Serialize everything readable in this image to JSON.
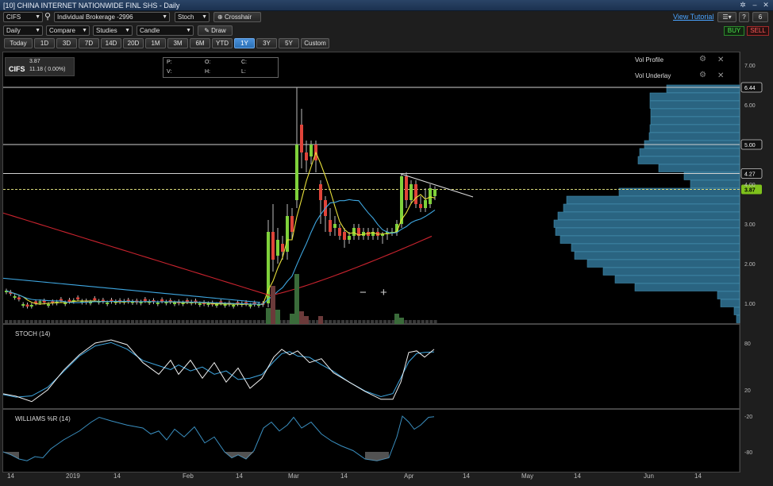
{
  "window": {
    "title": "[10] CHINA INTERNET NATIONWIDE FINL SHS - Daily"
  },
  "toolbar": {
    "symbol": "CIFS",
    "account": "Individual Brokerage -2996",
    "study_select": "Stoch",
    "crosshair_label": "Crosshair",
    "view_tutorial": "View Tutorial",
    "help": "?",
    "count": "6",
    "interval": "Daily",
    "compare": "Compare",
    "studies": "Studies",
    "chart_type": "Candle",
    "draw": "Draw",
    "buy": "BUY",
    "sell": "SELL"
  },
  "ranges": [
    "Today",
    "1D",
    "3D",
    "7D",
    "14D",
    "20D",
    "1M",
    "3M",
    "6M",
    "YTD",
    "1Y",
    "3Y",
    "5Y",
    "Custom"
  ],
  "active_range": "1Y",
  "quote": {
    "symbol": "CIFS",
    "last": "3.87",
    "volume_change": "11.18 ( 0.00%)"
  },
  "ohlc": {
    "p": "P:",
    "o": "O:",
    "c": "C:",
    "v": "V:",
    "h": "H:",
    "l": "L:"
  },
  "overlays": {
    "vol_profile": "Vol Profile",
    "vol_underlay": "Vol Underlay"
  },
  "zoom": {
    "minus": "−",
    "plus": "+"
  },
  "price_axis": [
    "7.00",
    "6.00",
    "5.00",
    "4.00",
    "3.00",
    "2.00",
    "1.00"
  ],
  "price_tags": {
    "hi1": "6.44",
    "hi2": "5.00",
    "hi3": "4.27",
    "last": "3.87"
  },
  "stoch": {
    "label": "STOCH (14)",
    "axis": [
      "80",
      "20"
    ]
  },
  "williams": {
    "label": "WILLIAMS %R (14)",
    "axis": [
      "-20",
      "-80"
    ]
  },
  "date_axis": [
    "14",
    "2019",
    "14",
    "Feb",
    "14",
    "Mar",
    "14",
    "Apr",
    "14",
    "May",
    "14",
    "Jun",
    "14"
  ],
  "colors": {
    "up": "#7fd13b",
    "down": "#e0443a",
    "ma_fast": "#e8e03a",
    "ma_mid": "#3ea6e0",
    "ma_slow": "#c9232e",
    "profile": "#2f6f8f"
  }
}
